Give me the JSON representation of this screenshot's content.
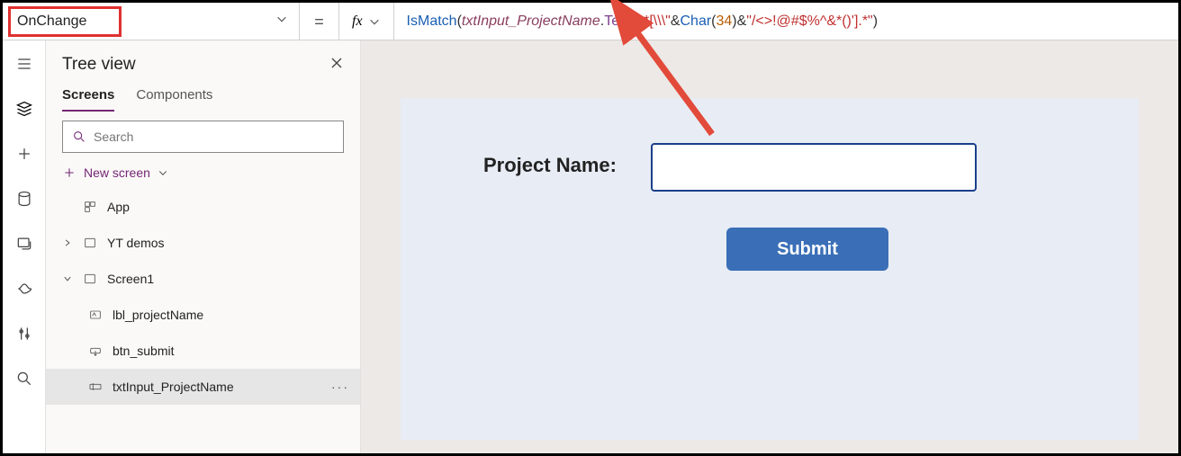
{
  "formula_bar": {
    "property": "OnChange",
    "equals": "=",
    "fx": "fx",
    "tokens": {
      "fn1": "IsMatch",
      "p1": "(",
      "id1": "txtInput_ProjectName",
      "dot": ".",
      "prop1": "Text",
      "c1": ",",
      "str1": "\".*[\\\\\\\"",
      "amp1": "&",
      "fn2": "Char",
      "p2": "(",
      "num1": "34",
      "p3": ")",
      "amp2": "&",
      "str2": "\"/<>!@#$%^&*()'].*\"",
      "p4": ")"
    }
  },
  "tree": {
    "title": "Tree view",
    "tabs": {
      "screens": "Screens",
      "components": "Components"
    },
    "search_placeholder": "Search",
    "new_screen": "New screen",
    "items": {
      "app": "App",
      "yt": "YT demos",
      "screen1": "Screen1",
      "lbl": "lbl_projectName",
      "btn": "btn_submit",
      "txt": "txtInput_ProjectName"
    }
  },
  "canvas": {
    "label": "Project Name:",
    "submit": "Submit"
  }
}
